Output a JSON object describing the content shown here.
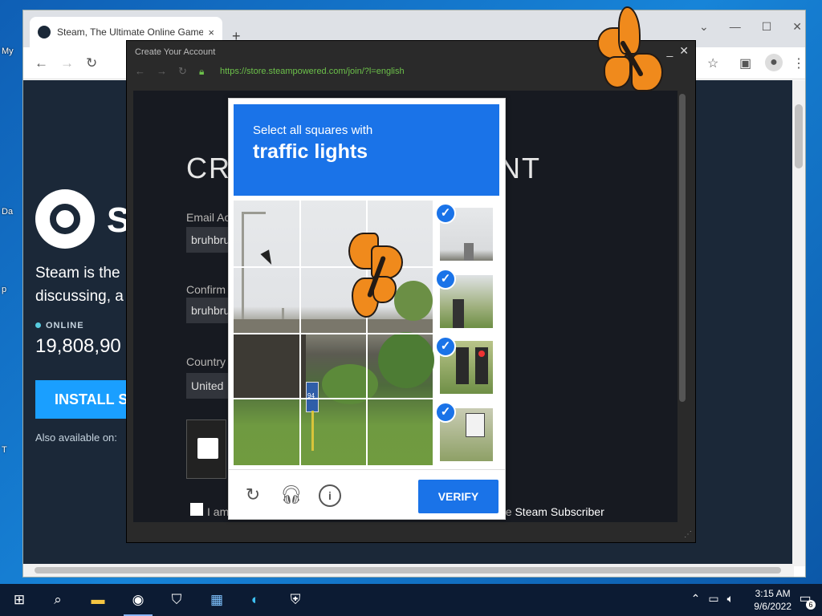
{
  "desktop": {
    "labels": [
      "My",
      "Da",
      "p",
      "T"
    ]
  },
  "chrome": {
    "tab_title": "Steam, The Ultimate Online Game",
    "tab_close": "×",
    "new_tab": "+",
    "win_min": "—",
    "win_max": "☐",
    "win_close": "✕"
  },
  "steam": {
    "wordmark": "S",
    "tagline_1": "Steam is the",
    "tagline_2": "discussing, a",
    "online_label": "ONLINE",
    "online_count": "19,808,90",
    "install_label": "INSTALL S",
    "also_available": "Also available on:"
  },
  "popup": {
    "title": "Create Your Account",
    "url": "https://store.steampowered.com/join/?l=english",
    "heading_start": "CRI",
    "heading_end": "NT",
    "email_label": "Email Ac",
    "email_value": "bruhbru",
    "confirm_label": "Confirm",
    "confirm_value": "bruhbru",
    "country_label": "Country",
    "country_value": "United",
    "agree_start": "I am",
    "agree_end_pre": "he",
    "agree_end_bold": "Steam Subscriber"
  },
  "captcha": {
    "instruction": "Select all squares with",
    "target": "traffic lights",
    "verify_label": "VERIFY",
    "check_glyph": "✓",
    "sign_text": "94"
  },
  "taskbar": {
    "time": "3:15 AM",
    "date": "9/6/2022",
    "notification_count": "6"
  },
  "colors": {
    "captcha_blue": "#1a73e8",
    "steam_bg": "#1b2838",
    "butterfly_orange": "#f08a1c"
  }
}
